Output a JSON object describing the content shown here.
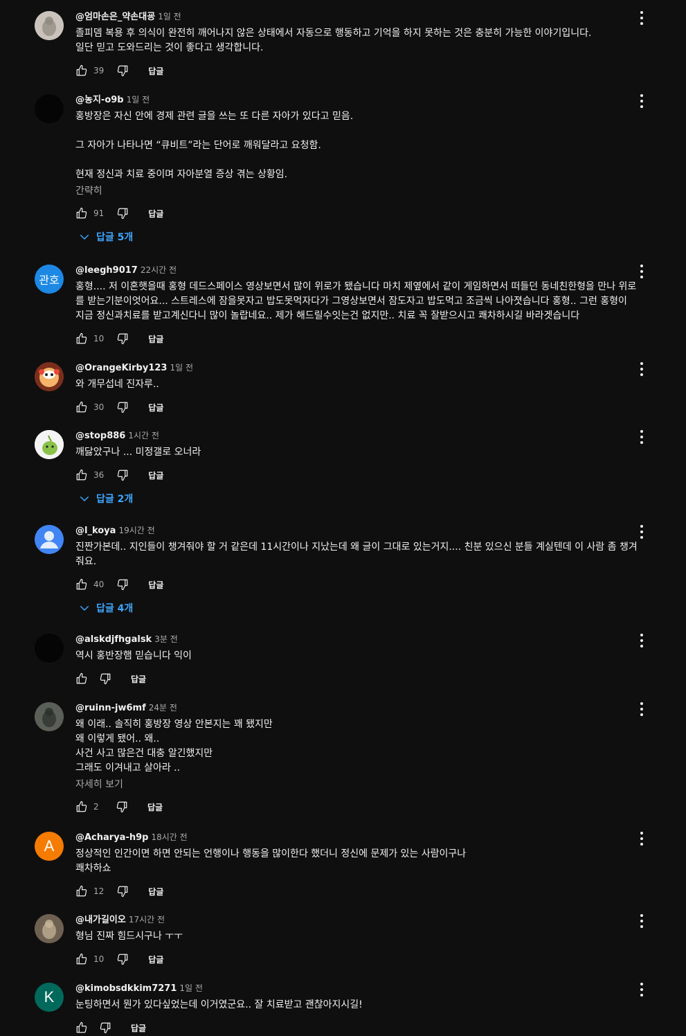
{
  "labels": {
    "reply": "답글"
  },
  "colors": {
    "background": "#0f0f0f",
    "link": "#3ea6ff",
    "muted": "#aaaaaa"
  },
  "comments": [
    {
      "author": "@엄마손은_약손대굥",
      "time": "1일 전",
      "avatar": {
        "kind": "photo",
        "bg": "#c9c3bb",
        "fg": "#8f877d"
      },
      "lines": [
        "졸피뎀 복용 후 의식이 완전히 깨어나지 않은 상태에서 자동으로 행동하고 기억을 하지 못하는 것은 충분히 가능한 이야기입니다.",
        "일단 믿고 도와드리는 것이 좋다고 생각합니다."
      ],
      "likes": "39"
    },
    {
      "author": "@농지-o9b",
      "time": "1일 전",
      "avatar": {
        "kind": "solid",
        "bg": "#050505"
      },
      "lines": [
        "홍방장은 자신 안에 경제 관련 글을 쓰는 또 다른 자아가 있다고 믿음.",
        "",
        "그 자아가 나타나면 “큐비트”라는 단어로 깨워달라고 요청함.",
        "",
        "현재 정신과 치료 중이며 자아분열 증상 겪는 상황임."
      ],
      "more": "간략히",
      "likes": "91",
      "replies": "답글 5개"
    },
    {
      "author": "@leegh9017",
      "time": "22시간 전",
      "avatar": {
        "kind": "letter",
        "bg": "#1e88e5",
        "letter": "관호"
      },
      "lines": [
        "홍형.... 저 이혼햇을때 홍형 데드스페이스 영상보면서 많이 위로가 됐습니다 마치 제옆에서 같이 게임하면서 떠들던 동네친한형을 만나 위로",
        "를 받는기분이엇어요... 스트레스에 잠을못자고 밥도못먹자다가 그영상보면서 잠도자고 밥도먹고 조금씩 나아졋습니다 홍형.. 그런 홍형이",
        "지금 정신과치료를 받고계신다니 많이 놀랍네요.. 제가 해드릴수잇는건 없지만.. 치료 꼭 잘받으시고 쾌차하시길 바라겟습니다"
      ],
      "likes": "10"
    },
    {
      "author": "@OrangeKirby123",
      "time": "1일 전",
      "avatar": {
        "kind": "kirby",
        "bg": "#7a2f1c"
      },
      "lines": [
        "와 개무섭네 진자루.."
      ],
      "likes": "30"
    },
    {
      "author": "@stop886",
      "time": "1시간 전",
      "avatar": {
        "kind": "green",
        "bg": "#f4f4f4"
      },
      "lines": [
        "깨닳았구나 ... 미정갤로 오너라"
      ],
      "likes": "36",
      "replies": "답글 2개"
    },
    {
      "author": "@l_koya",
      "time": "19시간 전",
      "avatar": {
        "kind": "default",
        "bg": "#4285f4"
      },
      "lines": [
        "진짠가본데.. 지인들이 챙겨줘야 할 거 같은데 11시간이나 지났는데 왜 글이 그대로 있는거지.... 친분 있으신 분들 계실텐데 이 사람 좀 챙겨",
        "줘요."
      ],
      "likes": "40",
      "replies": "답글 4개"
    },
    {
      "author": "@alskdjfhgalsk",
      "time": "3분 전",
      "avatar": {
        "kind": "solid",
        "bg": "#050505"
      },
      "lines": [
        "역시 홍반장햄 믿습니다 익이"
      ],
      "likes": ""
    },
    {
      "author": "@ruinn-jw6mf",
      "time": "24분 전",
      "avatar": {
        "kind": "photo",
        "bg": "#5a5f58",
        "fg": "#2b2f2a"
      },
      "lines": [
        "왜 이래.. 솔직히 홍방장 영상 안본지는 꽤 됐지만",
        "왜 이렇게 됐어.. 왜..",
        "사건 사고 많은건 대충 알긴했지만",
        "그래도 이겨내고 살아라 .."
      ],
      "more": "자세히 보기",
      "likes": "2"
    },
    {
      "author": "@Acharya-h9p",
      "time": "18시간 전",
      "avatar": {
        "kind": "letter",
        "bg": "#f57c00",
        "letter": "A"
      },
      "lines": [
        "정상적인 인간이면 하면 안되는 언행이나 행동을 많이한다 했더니 정신에 문제가 있는 사람이구나",
        "쾌차하쇼"
      ],
      "likes": "12"
    },
    {
      "author": "@내가길이오",
      "time": "17시간 전",
      "avatar": {
        "kind": "photo",
        "bg": "#6e6152",
        "fg": "#c8b89a"
      },
      "lines": [
        "형님 진짜 힘드시구나 ㅜㅜ"
      ],
      "likes": "10"
    },
    {
      "author": "@kimobsdkkim7271",
      "time": "1일 전",
      "avatar": {
        "kind": "letter",
        "bg": "#00695c",
        "letter": "K"
      },
      "lines": [
        "눈팅하면서 뭔가 있다싶었는데 이거였군요.. 잘 치료받고 괜찮아지시길!"
      ],
      "likes": ""
    }
  ]
}
